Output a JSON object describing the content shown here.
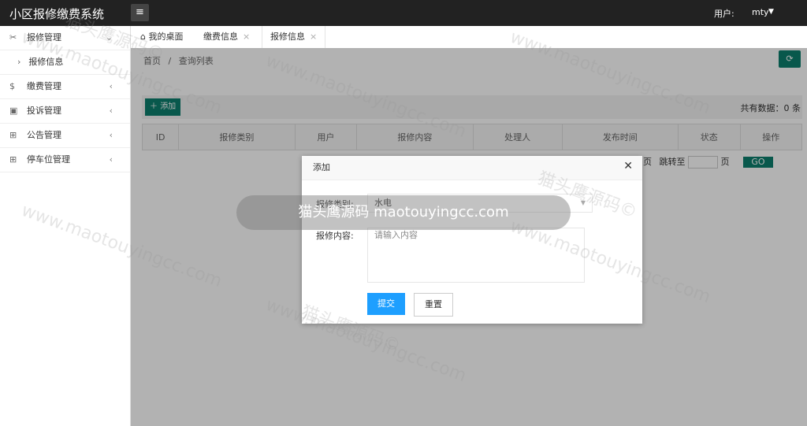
{
  "app": {
    "title": "小区报修缴费系统",
    "menu_icon": "hamburger-icon"
  },
  "user": {
    "label": "用户:",
    "name": "mty"
  },
  "sidebar": {
    "items": [
      {
        "icon": "tools-icon",
        "label": "报修管理",
        "sub": [
          {
            "label": "报修信息"
          }
        ]
      },
      {
        "icon": "dollar-icon",
        "label": "缴费管理"
      },
      {
        "icon": "clipboard-icon",
        "label": "投诉管理"
      },
      {
        "icon": "book-icon",
        "label": "公告管理"
      },
      {
        "icon": "book-icon",
        "label": "停车位管理"
      }
    ]
  },
  "tabs": [
    {
      "label": "我的桌面"
    },
    {
      "label": "缴费信息"
    },
    {
      "label": "报修信息"
    }
  ],
  "breadcrumb": {
    "home": "首页",
    "sep": "/",
    "current": "查询列表"
  },
  "toolbar": {
    "add_label": "添加",
    "count_label": "共有数据：0 条"
  },
  "table": {
    "columns": [
      "ID",
      "报修类别",
      "用户",
      "报修内容",
      "处理人",
      "发布时间",
      "状态",
      "操作"
    ]
  },
  "pager": {
    "page_suffix": "页",
    "jump_label": "跳转至",
    "page_word": "页",
    "go_label": "GO"
  },
  "modal": {
    "title": "添加",
    "category_label": "报修类别:",
    "category_value": "水电",
    "content_label": "报修内容:",
    "content_placeholder": "请输入内容",
    "submit_label": "提交",
    "reset_label": "重置"
  },
  "watermark": {
    "band_text": "猫头鹰源码 maotouyingcc.com",
    "text": "www.maotouyingcc.com",
    "cn": "猫头鹰源码©"
  },
  "colors": {
    "accent": "#0c7f6e",
    "primary": "#1e9fff",
    "header": "#222222"
  }
}
